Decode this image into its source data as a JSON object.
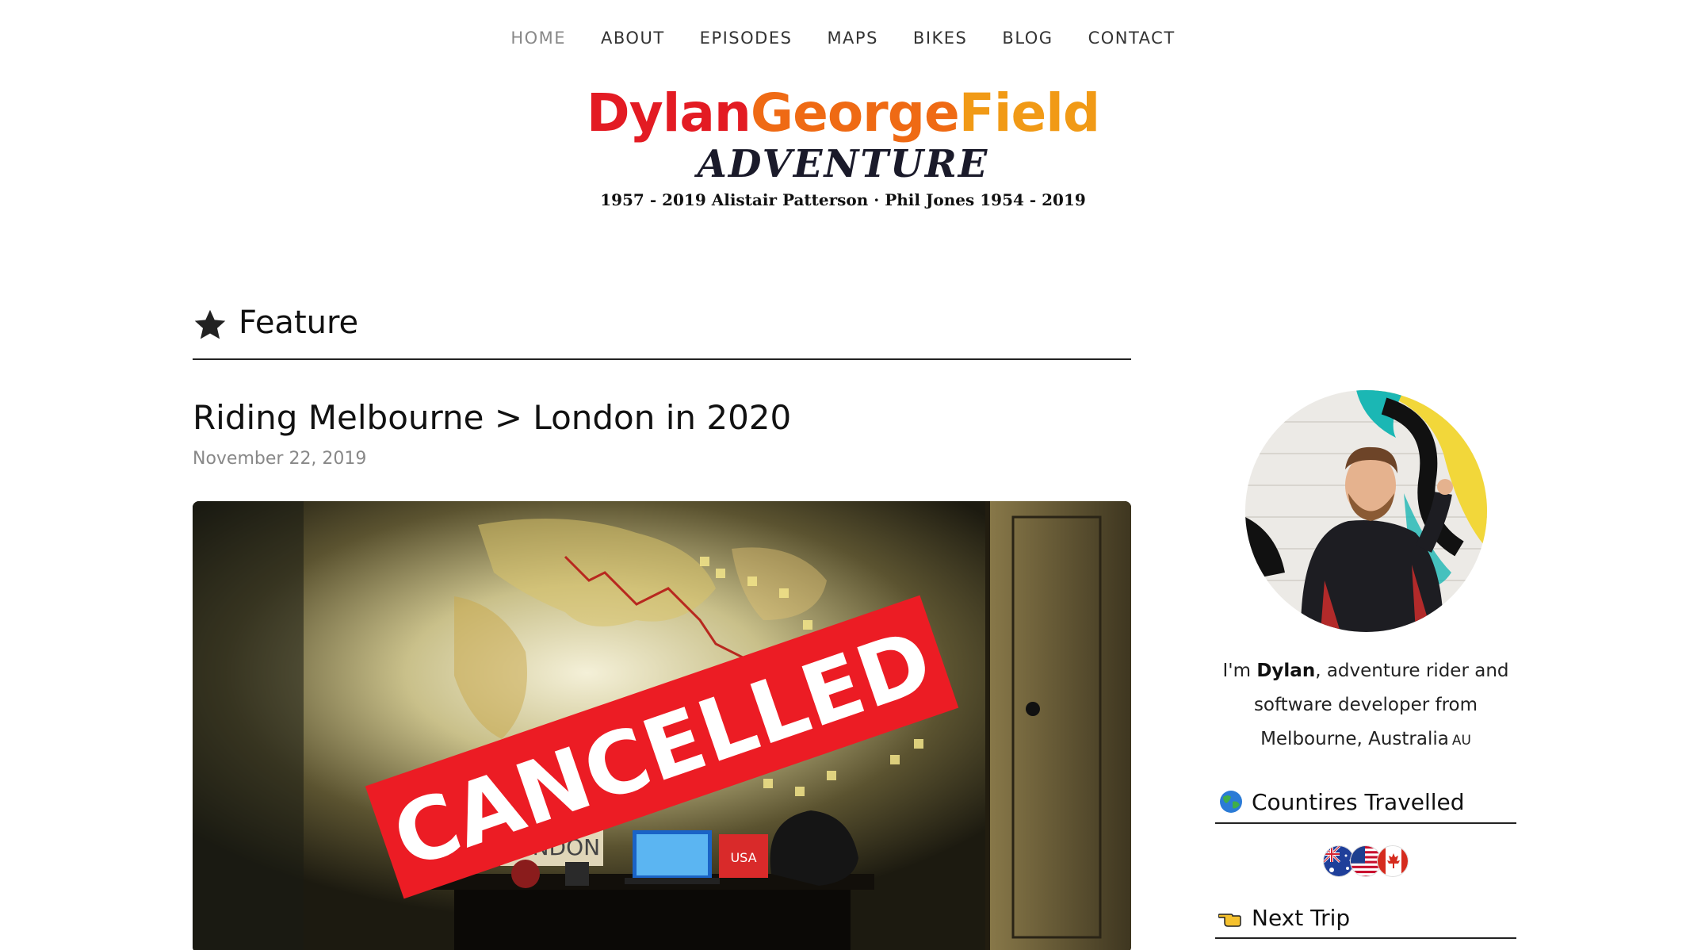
{
  "nav": {
    "items": [
      {
        "label": "HOME",
        "active": true
      },
      {
        "label": "ABOUT"
      },
      {
        "label": "EPISODES"
      },
      {
        "label": "MAPS"
      },
      {
        "label": "BIKES"
      },
      {
        "label": "BLOG"
      },
      {
        "label": "CONTACT"
      }
    ]
  },
  "logo": {
    "word1": "Dylan",
    "word2": "George",
    "word3": "Field",
    "subtitle": "Adventure",
    "memorial": "1957 - 2019 Alistair Patterson · Phil Jones 1954 - 2019",
    "colors": {
      "word1": "#e31b23",
      "word2": "#ef6a14",
      "word3": "#f19a16"
    }
  },
  "feature": {
    "heading": "Feature",
    "icon": "star-icon"
  },
  "post": {
    "title": "Riding Melbourne > London in 2020",
    "date": "November 22, 2019",
    "image": {
      "banner_text": "CANCELLED",
      "sign_text": "LONDON",
      "box_text": "USA",
      "banner_color": "#ec1c24"
    }
  },
  "sidebar": {
    "bio_prefix": "I'm ",
    "bio_name": "Dylan",
    "bio_suffix": ", adventure rider and software developer from Melbourne, Australia",
    "bio_country_code": "AU",
    "countries_heading": "Countires Travelled",
    "countries_icon": "globe-icon",
    "flags": [
      "australia-flag-icon",
      "usa-flag-icon",
      "canada-flag-icon"
    ],
    "next_trip_heading": "Next Trip",
    "next_trip_icon": "pointing-hand-icon"
  }
}
